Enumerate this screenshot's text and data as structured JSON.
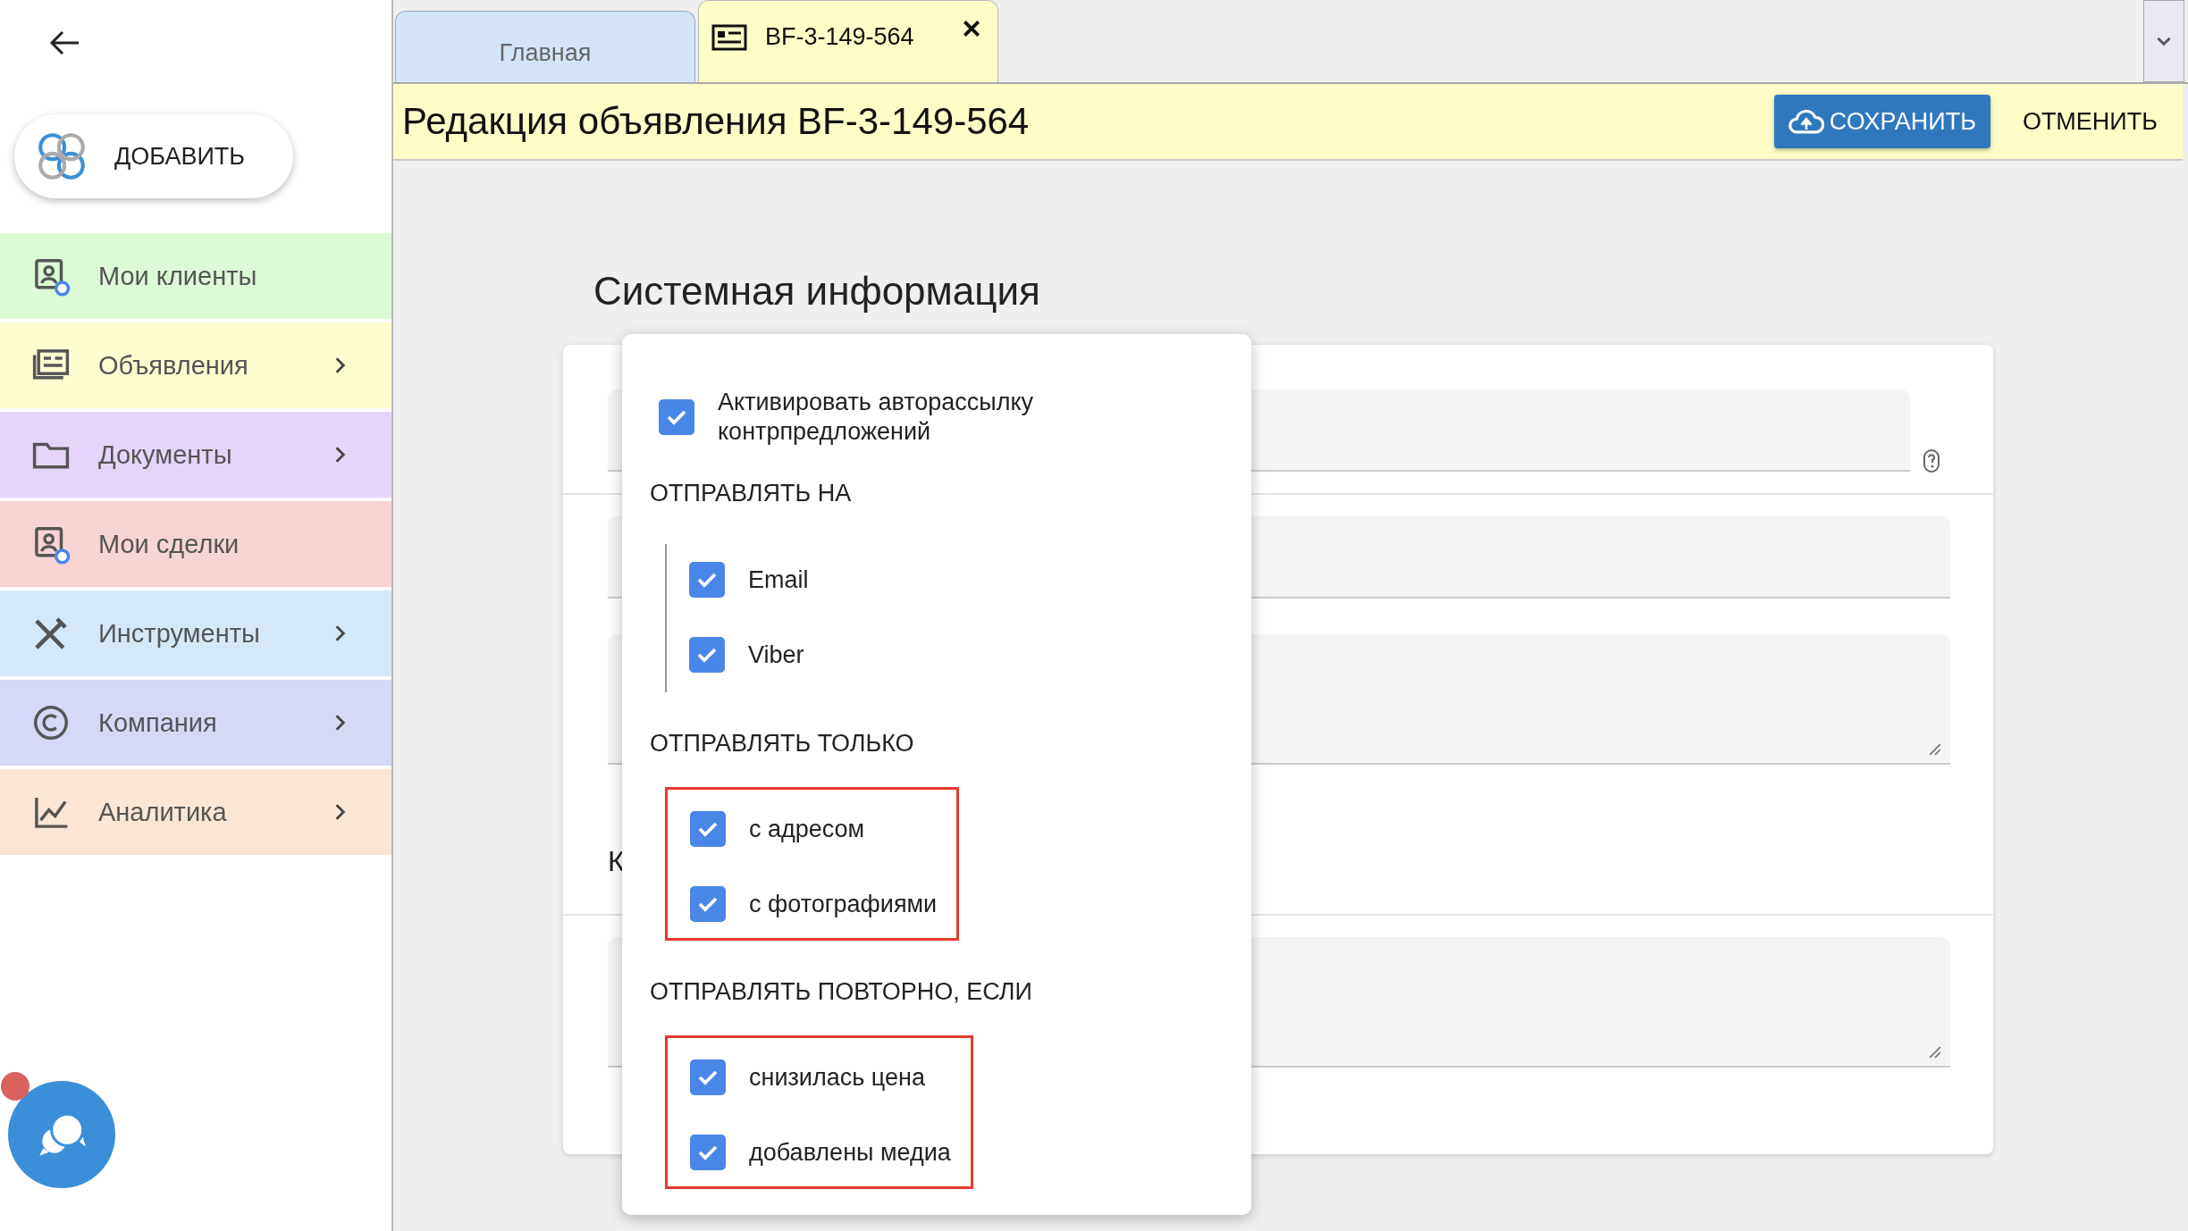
{
  "add_button": {
    "label": "ДОБАВИТЬ"
  },
  "sidebar": {
    "items": [
      {
        "label": "Мои клиенты",
        "color": "#dcfad6",
        "expandable": false
      },
      {
        "label": "Объявления",
        "color": "#fefdd0",
        "expandable": true
      },
      {
        "label": "Документы",
        "color": "#e6d5fb",
        "expandable": true
      },
      {
        "label": "Мои сделки",
        "color": "#f8d4d4",
        "expandable": false
      },
      {
        "label": "Инструменты",
        "color": "#d5e8f8",
        "expandable": true
      },
      {
        "label": "Компания",
        "color": "#d6d8f8",
        "expandable": true
      },
      {
        "label": "Аналитика",
        "color": "#fbe6d6",
        "expandable": true
      }
    ]
  },
  "chat": {
    "unread": true
  },
  "tabs": [
    {
      "label": "Главная",
      "selected": false,
      "closable": false
    },
    {
      "label": "BF-3-149-564",
      "selected": true,
      "closable": true
    }
  ],
  "header": {
    "title": "Редакция объявления BF-3-149-564",
    "save_label": "СОХРАНИТЬ",
    "cancel_label": "ОТМЕНИТЬ"
  },
  "section_title": "Системная информация",
  "form": {
    "subheading": "К"
  },
  "popup": {
    "main_option": {
      "label": "Активировать авторассылку контрпредложений",
      "checked": true
    },
    "groups": [
      {
        "title": "ОТПРАВЛЯТЬ НА",
        "highlighted": false,
        "options": [
          {
            "label": "Email",
            "checked": true
          },
          {
            "label": "Viber",
            "checked": true
          }
        ]
      },
      {
        "title": "ОТПРАВЛЯТЬ ТОЛЬКО",
        "highlighted": true,
        "options": [
          {
            "label": "с адресом",
            "checked": true
          },
          {
            "label": "с фотографиями",
            "checked": true
          }
        ]
      },
      {
        "title": "ОТПРАВЛЯТЬ ПОВТОРНО, ЕСЛИ",
        "highlighted": true,
        "options": [
          {
            "label": "снизилась цена",
            "checked": true
          },
          {
            "label": "добавлены медиа",
            "checked": true
          }
        ]
      }
    ]
  }
}
